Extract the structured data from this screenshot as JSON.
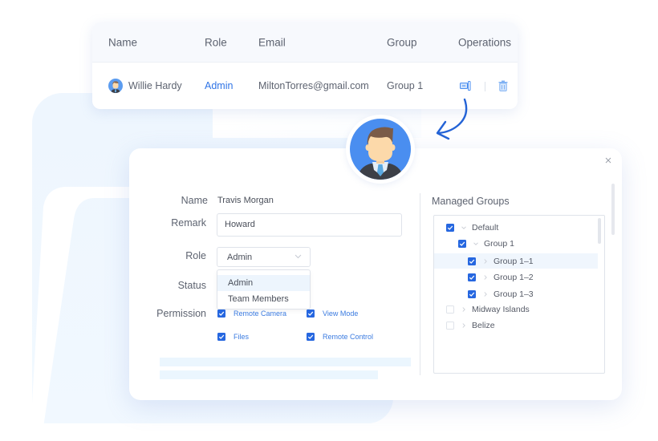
{
  "table": {
    "headers": {
      "name": "Name",
      "role": "Role",
      "email": "Email",
      "group": "Group",
      "operations": "Operations"
    },
    "row": {
      "name": "Willie Hardy",
      "role": "Admin",
      "email": "MiltonTorres@gmail.com",
      "group": "Group 1",
      "icons": {
        "edit": "edit-icon",
        "delete": "trash-icon"
      }
    }
  },
  "modal": {
    "close_icon": "close-icon",
    "fields": {
      "name_label": "Name",
      "name_value": "Travis Morgan",
      "remark_label": "Remark",
      "remark_value": "Howard",
      "role_label": "Role",
      "role_value": "Admin",
      "status_label": "Status",
      "permission_label": "Permission"
    },
    "role_options": [
      "Admin",
      "Team Members"
    ],
    "permissions": [
      {
        "label": "Remote Camera",
        "checked": true
      },
      {
        "label": "View Mode",
        "checked": true
      },
      {
        "label": "Files",
        "checked": true
      },
      {
        "label": "Remote Control",
        "checked": true
      }
    ],
    "managed_groups": {
      "title": "Managed Groups",
      "items": [
        {
          "label": "Default",
          "checked": true,
          "expanded": true
        },
        {
          "label": "Group 1",
          "checked": true,
          "expanded": true
        },
        {
          "label": "Group 1–1",
          "checked": true,
          "expanded": false,
          "highlighted": true
        },
        {
          "label": "Group 1–2",
          "checked": true,
          "expanded": false
        },
        {
          "label": "Group 1–3",
          "checked": true,
          "expanded": false
        },
        {
          "label": "Midway Islands",
          "checked": false,
          "expanded": false
        },
        {
          "label": "Belize",
          "checked": false,
          "expanded": false
        }
      ]
    }
  },
  "colors": {
    "accent": "#2667e0",
    "link": "#2f74e6",
    "avatar_bg": "#4a8ef0"
  }
}
